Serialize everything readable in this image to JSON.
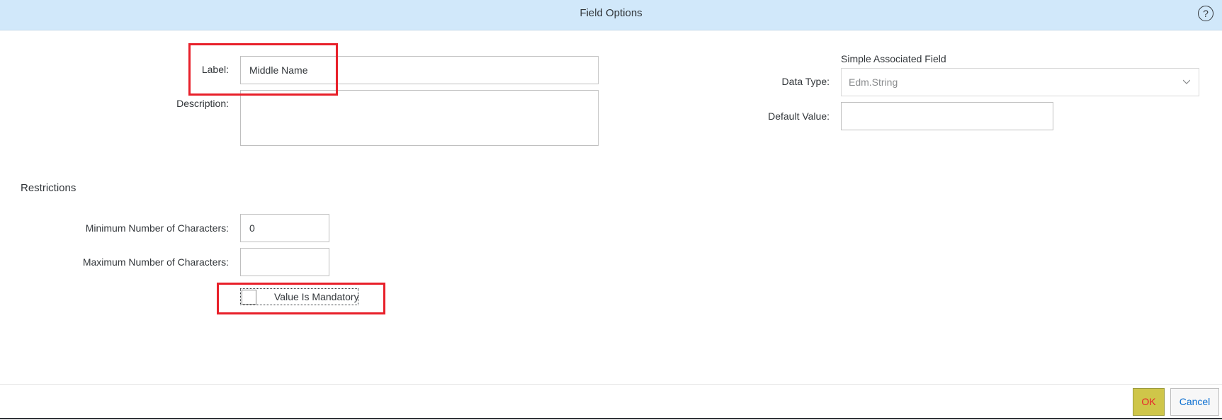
{
  "dialog": {
    "title": "Field Options",
    "help_icon": "?"
  },
  "form": {
    "label_label": "Label:",
    "label_value": "Middle Name",
    "description_label": "Description:",
    "description_value": "",
    "associated_field_label": "Simple Associated Field",
    "data_type_label": "Data Type:",
    "data_type_value": "Edm.String",
    "default_value_label": "Default Value:",
    "default_value": ""
  },
  "restrictions": {
    "title": "Restrictions",
    "min_label": "Minimum Number of Characters:",
    "min_value": "0",
    "max_label": "Maximum Number of Characters:",
    "max_value": "",
    "mandatory_label": "Value Is Mandatory",
    "mandatory_checked": false
  },
  "footer": {
    "ok_label": "OK",
    "cancel_label": "Cancel"
  },
  "colors": {
    "header_bg": "#d1e8fa",
    "highlight": "#e8202a",
    "ok_bg": "#cfc649",
    "cancel_text": "#0a6ed1"
  },
  "icons": {
    "help": "help-icon",
    "dropdown": "chevron-down-icon"
  }
}
